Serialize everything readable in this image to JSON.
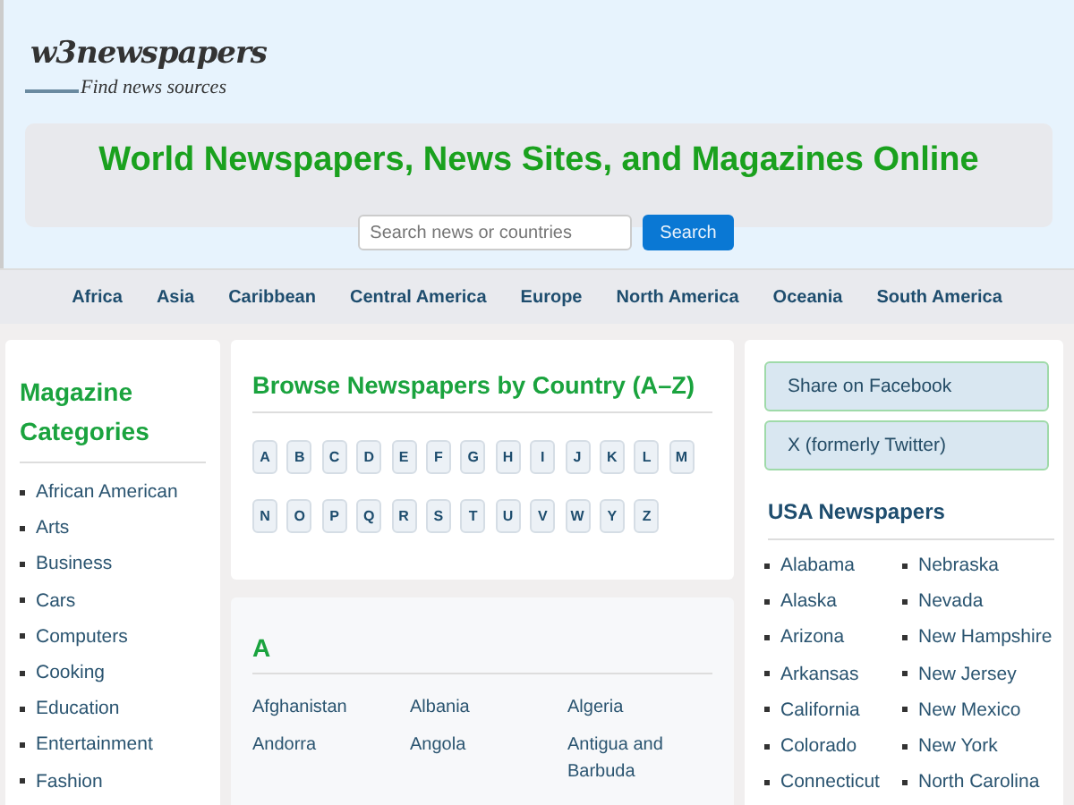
{
  "logo": {
    "name": "w3newspapers",
    "tagline": "Find news sources"
  },
  "banner": {
    "title": "World Newspapers, News Sites, and Magazines Online"
  },
  "search": {
    "placeholder": "Search news or countries",
    "button": "Search"
  },
  "nav": [
    "Africa",
    "Asia",
    "Caribbean",
    "Central America",
    "Europe",
    "North America",
    "Oceania",
    "South America"
  ],
  "magazines": {
    "title": "Magazine Categories",
    "items": [
      "African American",
      "Arts",
      "Business",
      "Cars",
      "Computers",
      "Cooking",
      "Education",
      "Entertainment",
      "Fashion"
    ]
  },
  "browse": {
    "title": "Browse Newspapers by Country (A–Z)",
    "letters": [
      [
        "A",
        "B",
        "C",
        "D",
        "E",
        "F",
        "G",
        "H",
        "I",
        "J",
        "K",
        "L",
        "M"
      ],
      [
        "N",
        "O",
        "P",
        "Q",
        "R",
        "S",
        "T",
        "U",
        "V",
        "W",
        "Y",
        "Z"
      ]
    ]
  },
  "section": {
    "letter": "A",
    "countries": [
      "Afghanistan",
      "Albania",
      "Algeria",
      "Andorra",
      "Angola",
      "Antigua and Barbuda"
    ]
  },
  "share": [
    "Share on Facebook",
    "X (formerly Twitter)"
  ],
  "usa": {
    "title": "USA Newspapers",
    "columns": [
      [
        "Alabama",
        "Alaska",
        "Arizona",
        "Arkansas",
        "California",
        "Colorado",
        "Connecticut"
      ],
      [
        "Nebraska",
        "Nevada",
        "New Hampshire",
        "New Jersey",
        "New Mexico",
        "New York",
        "North Carolina"
      ]
    ]
  }
}
